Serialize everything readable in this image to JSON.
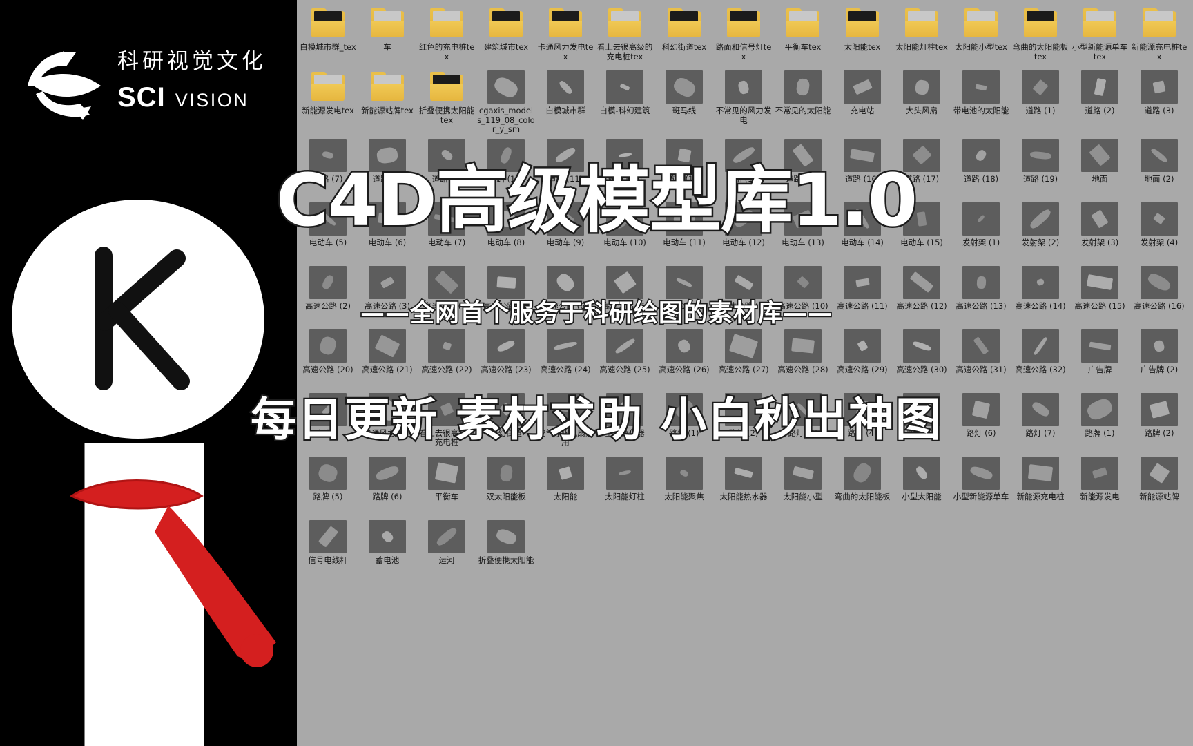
{
  "brand": {
    "logo_icon": "sci-vision-leaf-logo",
    "chinese_name": "科研视觉文化",
    "sci": "SCI",
    "vision": "VISION"
  },
  "overlay": {
    "title": "C4D高级模型库1.0",
    "subtitle": "——全网首个服务于科研绘图的素材库——",
    "banner": "每日更新 素材求助 小白秒出神图"
  },
  "mascot": {
    "icon": "stick-figure-mascot-with-red-scarf",
    "head_letter": "K",
    "scarf_color": "#d41f1f"
  },
  "desktop": {
    "background_color": "#a9a9a9",
    "columns": 15,
    "items": [
      {
        "label": "白模城市群_tex",
        "type": "folder"
      },
      {
        "label": "车",
        "type": "folder"
      },
      {
        "label": "红色的充电桩tex",
        "type": "folder"
      },
      {
        "label": "建筑城市tex",
        "type": "folder"
      },
      {
        "label": "卡通风力发电tex",
        "type": "folder"
      },
      {
        "label": "看上去很高级的充电桩tex",
        "type": "folder"
      },
      {
        "label": "科幻街道tex",
        "type": "folder"
      },
      {
        "label": "路面和信号灯tex",
        "type": "folder"
      },
      {
        "label": "平衡车tex",
        "type": "folder"
      },
      {
        "label": "太阳能tex",
        "type": "folder"
      },
      {
        "label": "太阳能灯柱tex",
        "type": "folder"
      },
      {
        "label": "太阳能小型tex",
        "type": "folder"
      },
      {
        "label": "弯曲的太阳能板tex",
        "type": "folder"
      },
      {
        "label": "小型新能源单车tex",
        "type": "folder"
      },
      {
        "label": "新能源充电桩tex",
        "type": "folder"
      },
      {
        "label": "新能源发电tex",
        "type": "folder"
      },
      {
        "label": "新能源站牌tex",
        "type": "folder"
      },
      {
        "label": "折叠便携太阳能tex",
        "type": "folder"
      },
      {
        "label": "cgaxis_models_119_08_color_y_sm",
        "type": "model"
      },
      {
        "label": "白模城市群",
        "type": "model"
      },
      {
        "label": "白模-科幻建筑",
        "type": "model"
      },
      {
        "label": "斑马线",
        "type": "model"
      },
      {
        "label": "不常见的风力发电",
        "type": "model"
      },
      {
        "label": "不常见的太阳能",
        "type": "model"
      },
      {
        "label": "充电站",
        "type": "model"
      },
      {
        "label": "大头风扇",
        "type": "model"
      },
      {
        "label": "带电池的太阳能",
        "type": "model"
      },
      {
        "label": "道路 (1)",
        "type": "model"
      },
      {
        "label": "道路 (2)",
        "type": "model"
      },
      {
        "label": "道路 (3)",
        "type": "model"
      },
      {
        "label": "道路 (7)",
        "type": "model"
      },
      {
        "label": "道路 (8)",
        "type": "model"
      },
      {
        "label": "道路 (9)",
        "type": "model"
      },
      {
        "label": "道路 (10)",
        "type": "model"
      },
      {
        "label": "道路 (11)",
        "type": "model"
      },
      {
        "label": "道路 (12)",
        "type": "model"
      },
      {
        "label": "道路 (13)",
        "type": "model"
      },
      {
        "label": "道路 (14)",
        "type": "model"
      },
      {
        "label": "道路 (15)",
        "type": "model"
      },
      {
        "label": "道路 (16)",
        "type": "model"
      },
      {
        "label": "道路 (17)",
        "type": "model"
      },
      {
        "label": "道路 (18)",
        "type": "model"
      },
      {
        "label": "道路 (19)",
        "type": "model"
      },
      {
        "label": "地面",
        "type": "model"
      },
      {
        "label": "地面 (2)",
        "type": "model"
      },
      {
        "label": "电动车 (5)",
        "type": "model"
      },
      {
        "label": "电动车 (6)",
        "type": "model"
      },
      {
        "label": "电动车 (7)",
        "type": "model"
      },
      {
        "label": "电动车 (8)",
        "type": "model"
      },
      {
        "label": "电动车 (9)",
        "type": "model"
      },
      {
        "label": "电动车 (10)",
        "type": "model"
      },
      {
        "label": "电动车 (11)",
        "type": "model"
      },
      {
        "label": "电动车 (12)",
        "type": "model"
      },
      {
        "label": "电动车 (13)",
        "type": "model"
      },
      {
        "label": "电动车 (14)",
        "type": "model"
      },
      {
        "label": "电动车 (15)",
        "type": "model"
      },
      {
        "label": "发射架 (1)",
        "type": "model"
      },
      {
        "label": "发射架 (2)",
        "type": "model"
      },
      {
        "label": "发射架 (3)",
        "type": "model"
      },
      {
        "label": "发射架 (4)",
        "type": "model"
      },
      {
        "label": "高速公路 (2)",
        "type": "model"
      },
      {
        "label": "高速公路 (3)",
        "type": "model"
      },
      {
        "label": "高速公路 (4)",
        "type": "model"
      },
      {
        "label": "高速公路 (5)",
        "type": "model"
      },
      {
        "label": "高速公路 (6)",
        "type": "model"
      },
      {
        "label": "高速公路 (7)",
        "type": "model"
      },
      {
        "label": "高速公路 (8)",
        "type": "model"
      },
      {
        "label": "高速公路 (9)",
        "type": "model"
      },
      {
        "label": "高速公路 (10)",
        "type": "model"
      },
      {
        "label": "高速公路 (11)",
        "type": "model"
      },
      {
        "label": "高速公路 (12)",
        "type": "model"
      },
      {
        "label": "高速公路 (13)",
        "type": "model"
      },
      {
        "label": "高速公路 (14)",
        "type": "model"
      },
      {
        "label": "高速公路 (15)",
        "type": "model"
      },
      {
        "label": "高速公路 (16)",
        "type": "model"
      },
      {
        "label": "高速公路 (20)",
        "type": "model"
      },
      {
        "label": "高速公路 (21)",
        "type": "model"
      },
      {
        "label": "高速公路 (22)",
        "type": "model"
      },
      {
        "label": "高速公路 (23)",
        "type": "model"
      },
      {
        "label": "高速公路 (24)",
        "type": "model"
      },
      {
        "label": "高速公路 (25)",
        "type": "model"
      },
      {
        "label": "高速公路 (26)",
        "type": "model"
      },
      {
        "label": "高速公路 (27)",
        "type": "model"
      },
      {
        "label": "高速公路 (28)",
        "type": "model"
      },
      {
        "label": "高速公路 (29)",
        "type": "model"
      },
      {
        "label": "高速公路 (30)",
        "type": "model"
      },
      {
        "label": "高速公路 (31)",
        "type": "model"
      },
      {
        "label": "高速公路 (32)",
        "type": "model"
      },
      {
        "label": "广告牌",
        "type": "model"
      },
      {
        "label": "广告牌 (2)",
        "type": "model"
      },
      {
        "label": "交通灯",
        "type": "model"
      },
      {
        "label": "卡通风力发电",
        "type": "model"
      },
      {
        "label": "看上去很高级的充电桩",
        "type": "model"
      },
      {
        "label": "科幻街道",
        "type": "model"
      },
      {
        "label": "空气净化风扇家用",
        "type": "model"
      },
      {
        "label": "空气净化器",
        "type": "model"
      },
      {
        "label": "路灯 (1)",
        "type": "model"
      },
      {
        "label": "路灯 (2)",
        "type": "model"
      },
      {
        "label": "路灯 (3)",
        "type": "model"
      },
      {
        "label": "路灯 (4)",
        "type": "model"
      },
      {
        "label": "路灯 (5)",
        "type": "model"
      },
      {
        "label": "路灯 (6)",
        "type": "model"
      },
      {
        "label": "路灯 (7)",
        "type": "model"
      },
      {
        "label": "路牌 (1)",
        "type": "model"
      },
      {
        "label": "路牌 (2)",
        "type": "model"
      },
      {
        "label": "路牌 (5)",
        "type": "model"
      },
      {
        "label": "路牌 (6)",
        "type": "model"
      },
      {
        "label": "平衡车",
        "type": "model"
      },
      {
        "label": "双太阳能板",
        "type": "model"
      },
      {
        "label": "太阳能",
        "type": "model"
      },
      {
        "label": "太阳能灯柱",
        "type": "model"
      },
      {
        "label": "太阳能聚焦",
        "type": "model"
      },
      {
        "label": "太阳能热水器",
        "type": "model"
      },
      {
        "label": "太阳能小型",
        "type": "model"
      },
      {
        "label": "弯曲的太阳能板",
        "type": "model"
      },
      {
        "label": "小型太阳能",
        "type": "model"
      },
      {
        "label": "小型新能源单车",
        "type": "model"
      },
      {
        "label": "新能源充电桩",
        "type": "model"
      },
      {
        "label": "新能源发电",
        "type": "model"
      },
      {
        "label": "新能源站牌",
        "type": "model"
      },
      {
        "label": "信号电线杆",
        "type": "model"
      },
      {
        "label": "蓄电池",
        "type": "model"
      },
      {
        "label": "运河",
        "type": "model"
      },
      {
        "label": "折叠便携太阳能",
        "type": "model"
      }
    ]
  }
}
